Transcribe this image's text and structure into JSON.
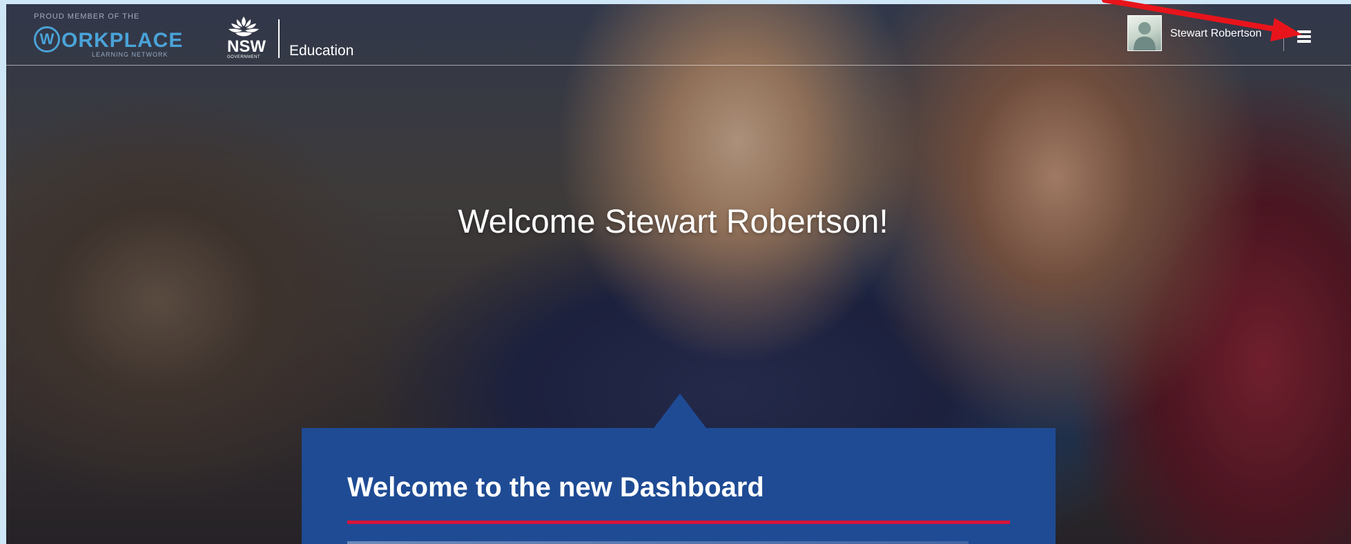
{
  "header": {
    "wln_logo": {
      "tagline": "PROUD MEMBER OF THE",
      "initial": "W",
      "wordmark": "ORKPLACE",
      "subline": "LEARNING NETWORK"
    },
    "nsw_logo": {
      "wordmark": "NSW",
      "gov_line": "GOVERNMENT",
      "department": "Education"
    },
    "user": {
      "name": "Stewart Robertson",
      "avatar_icon": "user-avatar-icon"
    },
    "menu_icon": "hamburger-menu-icon"
  },
  "hero": {
    "title": "Welcome Stewart Robertson!"
  },
  "welcome_card": {
    "heading": "Welcome to the new Dashboard"
  },
  "colors": {
    "card_blue": "#1f4b94",
    "accent_red": "#d7153a",
    "wln_blue": "#4aa3d8",
    "arrow_red": "#e8141c"
  }
}
